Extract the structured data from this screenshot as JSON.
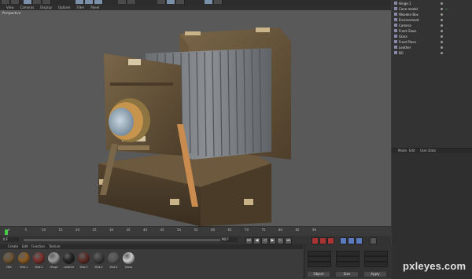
{
  "viewport": {
    "menu": [
      "View",
      "Cameras",
      "Display",
      "Options",
      "Filter",
      "Panel"
    ],
    "label": "Perspective"
  },
  "objects": [
    {
      "name": "Hinge.1"
    },
    {
      "name": "Cone model"
    },
    {
      "name": "Wooden Box"
    },
    {
      "name": "Environment"
    },
    {
      "name": "Camera"
    },
    {
      "name": "Front Glass"
    },
    {
      "name": "Glass"
    },
    {
      "name": "Front Piece"
    },
    {
      "name": "Leather"
    },
    {
      "name": "BG"
    }
  ],
  "attributes": {
    "menu": [
      "Mode",
      "Edit",
      "User Data"
    ]
  },
  "timeline": {
    "ticks": [
      "0",
      "5",
      "10",
      "15",
      "20",
      "25",
      "30",
      "35",
      "40",
      "45",
      "50",
      "55",
      "60",
      "65",
      "70",
      "75",
      "80",
      "85",
      "90"
    ],
    "frame_start": "0 F",
    "frame_current": "90 F"
  },
  "materials": {
    "menu": [
      "Create",
      "Edit",
      "Function",
      "Texture"
    ],
    "items": [
      {
        "label": "Mat",
        "color": "#6b5233"
      },
      {
        "label": "Mat.1",
        "color": "#8a5a22"
      },
      {
        "label": "Mat.2",
        "color": "#7a2f2a"
      },
      {
        "label": "Hinge",
        "color": "#999999"
      },
      {
        "label": "Leather",
        "color": "#222222"
      },
      {
        "label": "Mat.3",
        "color": "#5a2a24"
      },
      {
        "label": "Mat.4",
        "color": "#3a3a3a"
      },
      {
        "label": "Mat.5",
        "color": "#555555"
      },
      {
        "label": "Glass",
        "color": "#cccccc"
      }
    ]
  },
  "coordinates": {
    "buttons": [
      "Object",
      "Size",
      "Apply"
    ]
  },
  "watermark": "pxleyes.com"
}
